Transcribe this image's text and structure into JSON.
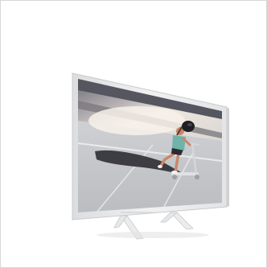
{
  "image": {
    "subject": "tv-product-photo",
    "colors": {
      "background": "#ffffff",
      "tv_frame": "#e9e9ea",
      "tv_frame_shadow": "#c9cacc",
      "sky_top": "#7c7d85",
      "sky_mid": "#b9b3b6",
      "sun_glow": "#f3ece6",
      "pavement": "#c7c9cc",
      "shadow_dark": "#2a2a30",
      "helmet": "#1f1f24",
      "skin": "#c9876a",
      "shirt": "#6fb2a9",
      "scooter": "#d7d9dc"
    }
  }
}
